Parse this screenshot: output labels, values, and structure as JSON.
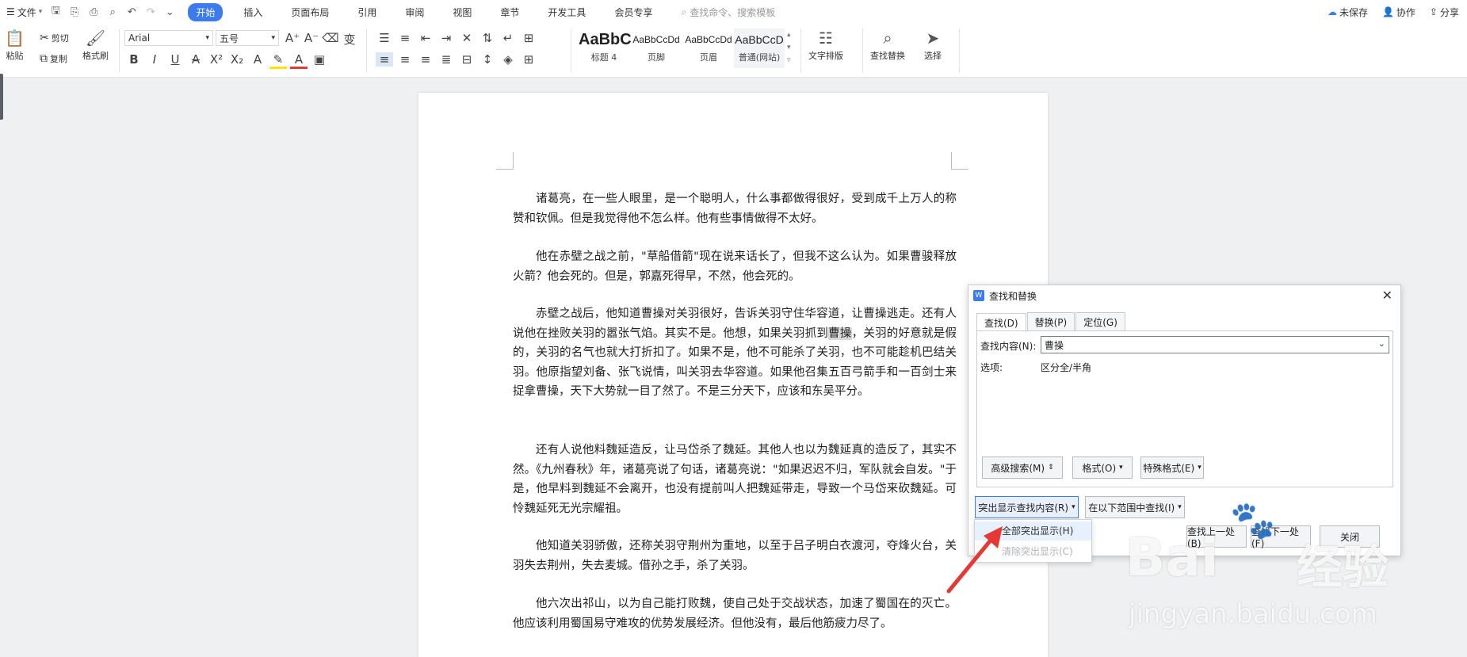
{
  "menubar": {
    "file": "文件",
    "tabs": [
      "开始",
      "插入",
      "页面布局",
      "引用",
      "审阅",
      "视图",
      "章节",
      "开发工具",
      "会员专享"
    ],
    "search_placeholder": "查找命令、搜索模板",
    "unsaved": "未保存",
    "collab": "协作",
    "share": "分享"
  },
  "ribbon": {
    "paste": "粘贴",
    "cut": "剪切",
    "copy": "复制",
    "format_painter": "格式刷",
    "font": "Arial",
    "size": "五号",
    "styles": [
      {
        "preview": "AaBbC",
        "name": "标题 4"
      },
      {
        "preview": "AaBbCcDd",
        "name": "页脚"
      },
      {
        "preview": "AaBbCcDd",
        "name": "页眉"
      },
      {
        "preview": "AaBbCcD",
        "name": "普通(网站)"
      }
    ],
    "text_layout": "文字排版",
    "find_replace": "查找替换",
    "select": "选择"
  },
  "document": {
    "paragraphs": [
      "诸葛亮，在一些人眼里，是一个聪明人，什么事都做得很好，受到成千上万人的称赞和钦佩。但是我觉得他不怎么样。他有些事情做得不太好。",
      "他在赤壁之战之前，\"草船借箭\"现在说来话长了，但我不这么认为。如果曹骏释放火箭？他会死的。但是，郭嘉死得早，不然，他会死的。",
      "赤壁之战后，他知道曹操对关羽很好，告诉关羽守住华容道，让曹操逃走。还有人说他在挫败关羽的嚣张气焰。其实不是。他想，如果关羽抓到曹操，关羽的好意就是假的，关羽的名气也就大打折扣了。如果不是，他不可能杀了关羽，也不可能趁机巴结关羽。他原指望刘备、张飞说情，叫关羽去华容道。如果他召集五百弓箭手和一百剑士来捉拿曹操，天下大势就一目了然了。不是三分天下，应该和东吴平分。",
      "还有人说他料魏延造反，让马岱杀了魏延。其他人也以为魏延真的造反了，其实不然。《九州春秋》年，诸葛亮说了句话，诸葛亮说：\"如果迟迟不归，军队就会自发。\"于是，他早料到魏延不会离开，也没有提前叫人把魏延带走，导致一个马岱来砍魏延。可怜魏延死无光宗耀祖。",
      "他知道关羽骄傲，还称关羽守荆州为重地，以至于吕子明白衣渡河，夺烽火台，关羽失去荆州，失去麦城。借孙之手，杀了关羽。",
      "他六次出祁山，以为自己能打败魏，使自己处于交战状态，加速了蜀国在的灭亡。他应该利用蜀国易守难攻的优势发展经济。但他没有，最后他筋疲力尽了。"
    ],
    "p3_before": "赤壁之战后，他知道曹操对关羽很好，告诉关羽守住华容道，让曹操逃走。还有人说他在挫败关羽的嚣张气焰。其实不是。他想，如果关羽抓到",
    "p3_highlight": "曹操",
    "p3_after": "，关羽的好意就是假的，关羽的名气也就大打折扣了。如果不是，他不可能杀了关羽，也不可能趁机巴结关羽。他原指望刘备、张飞说情，叫关羽去华容道。如果他召集五百弓箭手和一百剑士来捉拿曹操，天下大势就一目了然了。不是三分天下，应该和东吴平分。"
  },
  "dialog": {
    "title": "查找和替换",
    "tabs": [
      "查找(D)",
      "替换(P)",
      "定位(G)"
    ],
    "find_label": "查找内容(N):",
    "find_value": "曹操",
    "options_label": "选项:",
    "options_value": "区分全/半角",
    "advanced": "高级搜索(M)",
    "format": "格式(O)",
    "special": "特殊格式(E)",
    "highlight": "突出显示查找内容(R)",
    "find_in": "在以下范围中查找(I)",
    "find_prev": "查找上一处(B)",
    "find_next": "查找下一处(F)",
    "close": "关闭"
  },
  "highlight_menu": {
    "items": [
      {
        "label": "全部突出显示(H)",
        "state": "hover"
      },
      {
        "label": "清除突出显示(C)",
        "state": "disabled"
      }
    ]
  },
  "watermark": {
    "brand": "Bai",
    "brand_cn": "经验",
    "url": "jingyan.baidu.com"
  },
  "colors": {
    "accent": "#3c7af0",
    "arrow": "#e53935"
  }
}
